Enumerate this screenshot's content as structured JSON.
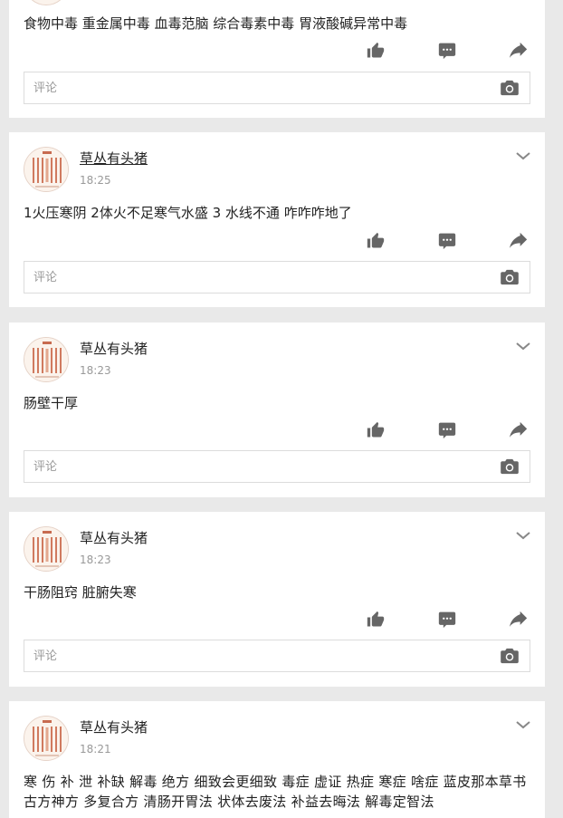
{
  "colors": {
    "background": "#e9e9e9",
    "card": "#ffffff",
    "icon": "#666666",
    "text": "#222222",
    "muted": "#999999"
  },
  "posts": [
    {
      "text": "食物中毒 重金属中毒 血毒范脑 综合毒素中毒 胃液酸碱异常中毒",
      "comment_placeholder": "评论"
    },
    {
      "author": "草丛有头猪",
      "time": "18:25",
      "text": "1火压寒阴 2体火不足寒气水盛 3 水线不通 咋咋咋地了",
      "comment_placeholder": "评论"
    },
    {
      "author": "草丛有头猪",
      "time": "18:23",
      "text": "肠壁干厚",
      "comment_placeholder": "评论"
    },
    {
      "author": "草丛有头猪",
      "time": "18:23",
      "text": "干肠阻窍 脏腑失寒",
      "comment_placeholder": "评论"
    },
    {
      "author": "草丛有头猪",
      "time": "18:21",
      "text": "寒 伤 补 泄 补缺 解毒 绝方 细致会更细致 毒症 虚证 热症 寒症 啥症 蓝皮那本草书 古方神方 多复合方 清肠开胃法 状体去废法 补益去晦法 解毒定智法"
    }
  ],
  "icons": {
    "like": "thumbs-up-icon",
    "comment": "comment-bubble-icon",
    "share": "share-arrow-icon",
    "camera": "camera-icon",
    "more": "chevron-down-icon"
  }
}
